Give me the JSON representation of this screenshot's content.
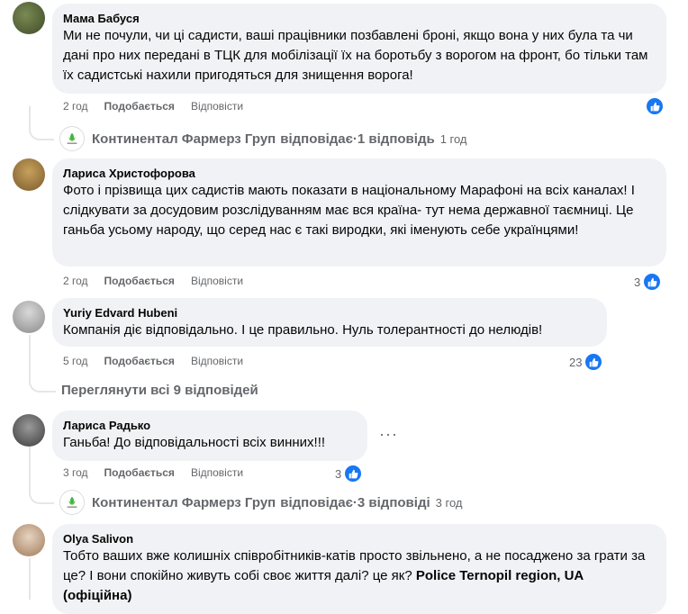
{
  "comments": [
    {
      "author": "Мама Бабуся",
      "text": "Ми не почули, чи ці садисти, ваші працівники позбавлені броні, якщо вона у них була та чи дані про них передані в ТЦК для мобілізації їх на боротьбу з ворогом на фронт, бо тільки там їх садистські нахили пригодяться для знищення ворога!",
      "time": "2 год",
      "like": "Подобається",
      "reply": "Відповісти",
      "reactions": ""
    },
    {
      "author": "Лариса Христофорова",
      "text": "Фото і прізвища цих садистів мають показати в національному Марафоні на всіх каналах! І слідкувати за досудовим розслідуванням має вся країна- тут нема державної таємниці. Це ганьба усьому народу, що серед нас є такі виродки, які іменують себе українцями!",
      "time": "2 год",
      "like": "Подобається",
      "reply": "Відповісти",
      "reactions": "3"
    },
    {
      "author": "Yuriy Edvard Hubeni",
      "text": "Компанія діє відповідально. І це правильно. Нуль толерантності до нелюдів!",
      "time": "5 год",
      "like": "Подобається",
      "reply": "Відповісти",
      "reactions": "23"
    },
    {
      "author": "Лариса Радько",
      "text": "Ганьба! До відповідальності всіх винних!!!",
      "time": "3 год",
      "like": "Подобається",
      "reply": "Відповісти",
      "reactions": "3"
    },
    {
      "author": "Olya Salivon",
      "text": "Тобто ваших вже колишніх співробітників-катів просто звільнено, а не посаджено за грати за це? І вони спокійно живуть собі своє життя далі? це як?",
      "mention": "Police Ternopil region, UA (офіційна)"
    }
  ],
  "replies": [
    {
      "page": "Континентал Фармерз Груп",
      "verb": "відповідає",
      "sep": " · ",
      "count": "1 відповідь",
      "time": "1 год"
    },
    {
      "page": "Континентал Фармерз Груп",
      "verb": "відповідає",
      "sep": " · ",
      "count": "3 відповіді",
      "time": "3 год"
    }
  ],
  "view_more": "Переглянути всі 9 відповідей",
  "more_options": "···",
  "colors": {
    "like_blue": "#1877f2",
    "bubble": "#f0f2f5",
    "muted": "#65676b"
  }
}
